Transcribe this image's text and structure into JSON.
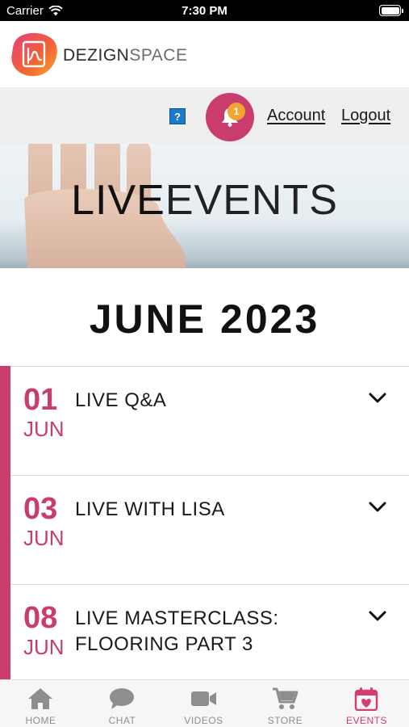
{
  "status_bar": {
    "carrier": "Carrier",
    "time": "7:30 PM"
  },
  "header": {
    "brand_part1": "DEZIGN",
    "brand_part2": "SPACE"
  },
  "account_bar": {
    "help_icon_text": "?",
    "notification_count": "1",
    "account_label": "Account",
    "logout_label": "Logout"
  },
  "hero": {
    "title_part1": "LIVE",
    "title_part2": "EVENTS"
  },
  "month_heading": "JUNE 2023",
  "events": [
    {
      "day": "01",
      "month": "JUN",
      "title": "LIVE Q&A"
    },
    {
      "day": "03",
      "month": "JUN",
      "title": "LIVE WITH LISA"
    },
    {
      "day": "08",
      "month": "JUN",
      "title": "LIVE MASTERCLASS: FLOORING PART 3"
    }
  ],
  "tabs": [
    {
      "label": "HOME",
      "icon": "home-icon"
    },
    {
      "label": "CHAT",
      "icon": "chat-icon"
    },
    {
      "label": "VIDEOS",
      "icon": "video-icon"
    },
    {
      "label": "STORE",
      "icon": "cart-icon"
    },
    {
      "label": "EVENTS",
      "icon": "calendar-heart-icon",
      "active": true
    }
  ],
  "colors": {
    "accent": "#c93c6d",
    "badge": "#f3a533",
    "tab_active": "#d43c74",
    "tab_inactive": "#8e8e8e"
  }
}
